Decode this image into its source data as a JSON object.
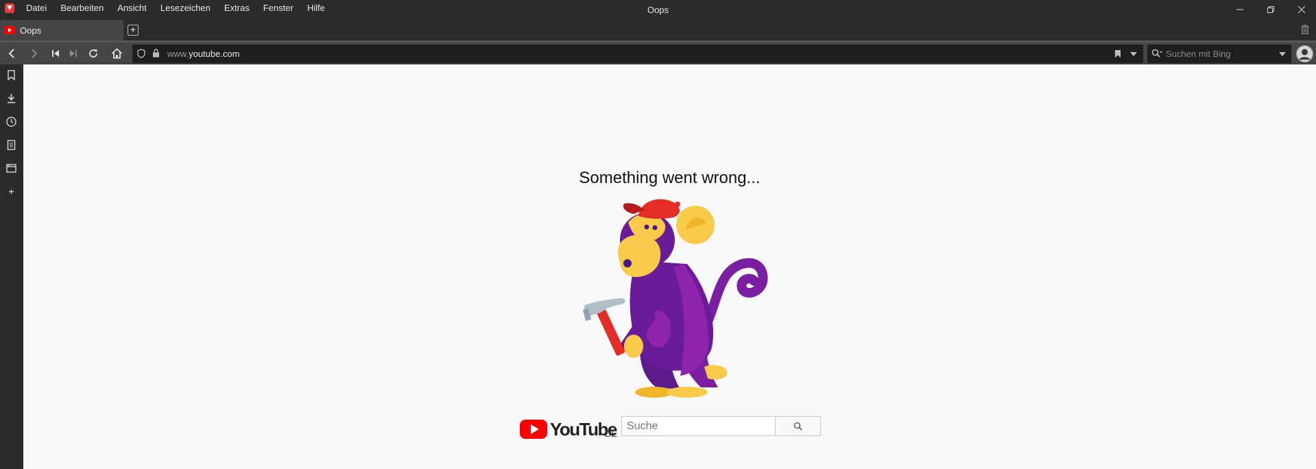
{
  "window": {
    "title": "Oops",
    "menu": [
      "Datei",
      "Bearbeiten",
      "Ansicht",
      "Lesezeichen",
      "Extras",
      "Fenster",
      "Hilfe"
    ]
  },
  "tabs": [
    {
      "label": "Oops",
      "favicon": "youtube-icon",
      "active": true
    }
  ],
  "address_bar": {
    "url_prefix": "www.",
    "url_domain": "youtube.com",
    "search_placeholder": "Suchen mit Bing"
  },
  "sidebar": {
    "items": [
      "bookmarks-icon",
      "downloads-icon",
      "history-icon",
      "notes-icon",
      "window-panel-icon",
      "add-panel-icon"
    ]
  },
  "page": {
    "error_title": "Something went wrong...",
    "brand": "YouTube",
    "region": "DE",
    "search_placeholder": "Suche"
  },
  "colors": {
    "chrome_dark": "#2b2b2b",
    "chrome_mid": "#454545",
    "youtube_red": "#ff0000",
    "monkey_purple": "#6a1b9a",
    "monkey_yellow": "#f7ca4a",
    "cap_red": "#e52d27"
  }
}
